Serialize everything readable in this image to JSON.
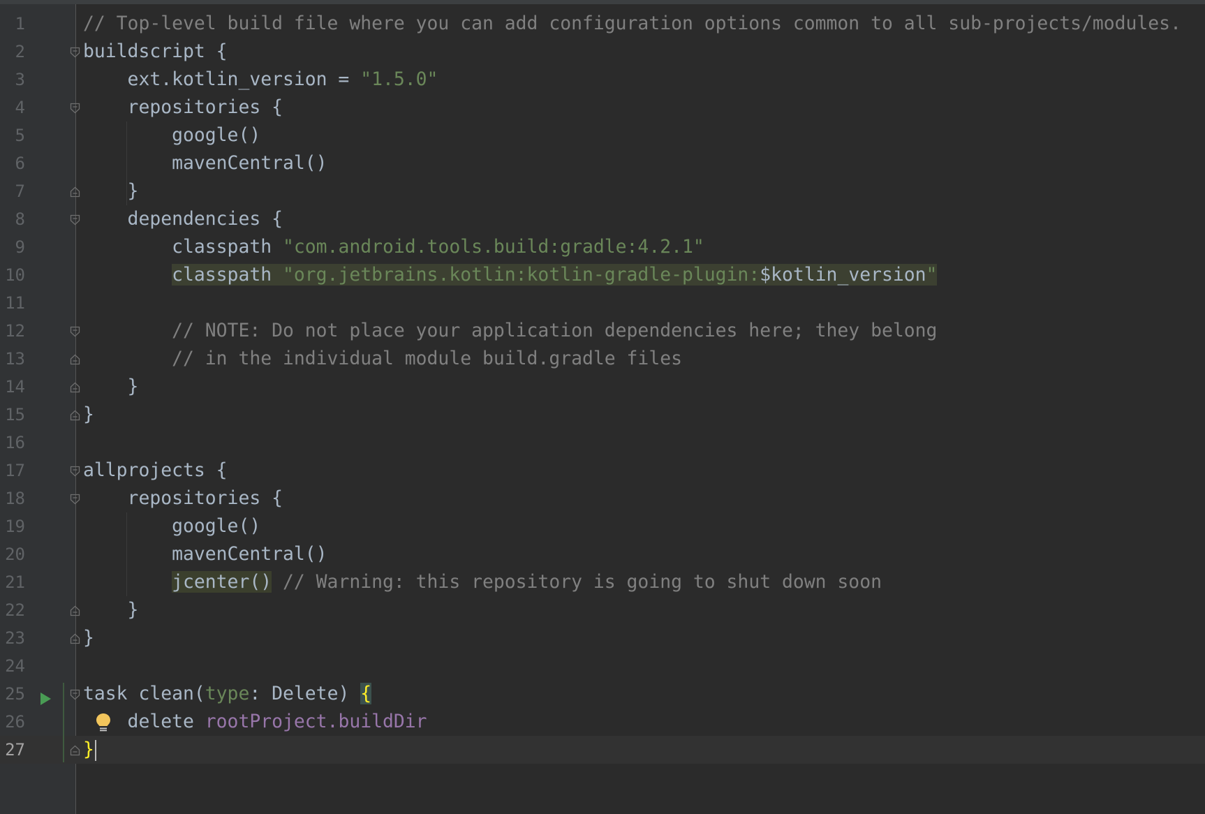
{
  "editor": {
    "lines": [
      {
        "num": "1",
        "tokens": [
          {
            "t": "// Top-level build file where you can add configuration options common to all sub-projects/modules.",
            "c": "cmt"
          }
        ]
      },
      {
        "num": "2",
        "tokens": [
          {
            "t": "buildscript {",
            "c": ""
          }
        ]
      },
      {
        "num": "3",
        "tokens": [
          {
            "t": "    ext.kotlin_version = ",
            "c": ""
          },
          {
            "t": "\"1.5.0\"",
            "c": "str"
          }
        ]
      },
      {
        "num": "4",
        "tokens": [
          {
            "t": "    repositories {",
            "c": ""
          }
        ]
      },
      {
        "num": "5",
        "tokens": [
          {
            "t": "        google()",
            "c": ""
          }
        ]
      },
      {
        "num": "6",
        "tokens": [
          {
            "t": "        mavenCentral()",
            "c": ""
          }
        ]
      },
      {
        "num": "7",
        "tokens": [
          {
            "t": "    }",
            "c": ""
          }
        ]
      },
      {
        "num": "8",
        "tokens": [
          {
            "t": "    dependencies {",
            "c": ""
          }
        ]
      },
      {
        "num": "9",
        "tokens": [
          {
            "t": "        classpath ",
            "c": ""
          },
          {
            "t": "\"com.android.tools.build:gradle:4.2.1\"",
            "c": "str"
          }
        ]
      },
      {
        "num": "10",
        "tokens": [
          {
            "t": "        ",
            "c": ""
          },
          {
            "t": "classpath ",
            "c": "hl-bg"
          },
          {
            "t": "\"org.jetbrains.kotlin:kotlin-gradle-plugin:",
            "c": "hl-bg str"
          },
          {
            "t": "$kotlin_version",
            "c": "hl-bg var-ref"
          },
          {
            "t": "\"",
            "c": "hl-bg str"
          }
        ]
      },
      {
        "num": "11",
        "tokens": []
      },
      {
        "num": "12",
        "tokens": [
          {
            "t": "        // NOTE: Do not place your application dependencies here; they belong",
            "c": "cmt"
          }
        ]
      },
      {
        "num": "13",
        "tokens": [
          {
            "t": "        // in the individual module build.gradle files",
            "c": "cmt"
          }
        ]
      },
      {
        "num": "14",
        "tokens": [
          {
            "t": "    }",
            "c": ""
          }
        ]
      },
      {
        "num": "15",
        "tokens": [
          {
            "t": "}",
            "c": ""
          }
        ]
      },
      {
        "num": "16",
        "tokens": []
      },
      {
        "num": "17",
        "tokens": [
          {
            "t": "allprojects {",
            "c": ""
          }
        ]
      },
      {
        "num": "18",
        "tokens": [
          {
            "t": "    repositories {",
            "c": ""
          }
        ]
      },
      {
        "num": "19",
        "tokens": [
          {
            "t": "        google()",
            "c": ""
          }
        ]
      },
      {
        "num": "20",
        "tokens": [
          {
            "t": "        mavenCentral()",
            "c": ""
          }
        ]
      },
      {
        "num": "21",
        "tokens": [
          {
            "t": "        ",
            "c": ""
          },
          {
            "t": "jcenter()",
            "c": "warn-bg"
          },
          {
            "t": " // Warning: this repository is going to shut down soon",
            "c": "cmt"
          }
        ]
      },
      {
        "num": "22",
        "tokens": [
          {
            "t": "    }",
            "c": ""
          }
        ]
      },
      {
        "num": "23",
        "tokens": [
          {
            "t": "}",
            "c": ""
          }
        ]
      },
      {
        "num": "24",
        "tokens": []
      },
      {
        "num": "25",
        "tokens": [
          {
            "t": "task clean(",
            "c": ""
          },
          {
            "t": "type",
            "c": "named"
          },
          {
            "t": ": Delete) ",
            "c": ""
          },
          {
            "t": "{",
            "c": "brace-match"
          }
        ]
      },
      {
        "num": "26",
        "tokens": [
          {
            "t": "    delete ",
            "c": ""
          },
          {
            "t": "rootProject.buildDir",
            "c": "prop"
          }
        ]
      },
      {
        "num": "27",
        "tokens": [
          {
            "t": "}",
            "c": "brace-yellow"
          }
        ]
      }
    ],
    "fold_open_lines": [
      "2",
      "4",
      "8",
      "12",
      "17",
      "18",
      "25"
    ],
    "fold_close_lines": [
      "7",
      "13",
      "14",
      "15",
      "22",
      "23",
      "27"
    ],
    "run_line": "25",
    "bulb_line": "26",
    "current_line": "27",
    "colors": {
      "background": "#2b2b2b",
      "comment": "#808080",
      "string": "#6a8759",
      "property": "#9876aa",
      "brace_match": "#ffef28",
      "run_icon": "#499c54",
      "bulb": "#f2c55c"
    }
  }
}
